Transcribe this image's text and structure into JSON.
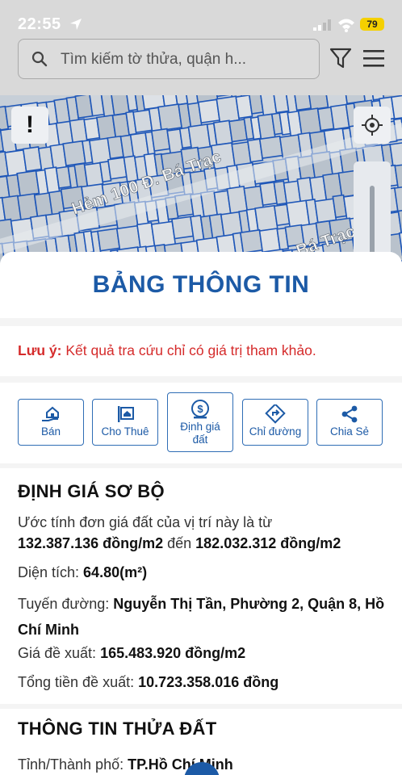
{
  "status": {
    "time": "22:55",
    "battery": "79"
  },
  "search": {
    "placeholder": "Tìm kiếm tờ thửa, quận h..."
  },
  "map": {
    "road_label": "Hẻm 100 Đ. Bá Trạc",
    "road_label_2": "Bá Trạc",
    "alert_symbol": "!"
  },
  "panel": {
    "title": "BẢNG THÔNG TIN",
    "note_label": "Lưu ý:",
    "note_text": " Kết quả tra cứu chỉ có giá trị tham khảo."
  },
  "actions": [
    {
      "label": "Bán",
      "icon": "house-hand-icon"
    },
    {
      "label": "Cho Thuê",
      "icon": "rent-sign-icon"
    },
    {
      "label": "Định giá đất",
      "icon": "money-bag-icon"
    },
    {
      "label": "Chỉ đường",
      "icon": "direction-icon"
    },
    {
      "label": "Chia Sẻ",
      "icon": "share-icon"
    }
  ],
  "valuation": {
    "heading": "ĐỊNH GIÁ SƠ BỘ",
    "estimate_prefix": "Ước tính đơn giá đất của vị trí này là từ",
    "price_min": "132.387.136 đồng/m2",
    "between": " đến ",
    "price_max": "182.032.312 đồng/m2",
    "area_label": "Diện tích: ",
    "area_value": "64.80(m²)",
    "road_label": "Tuyến đường: ",
    "road_value": "Nguyễn Thị Tần, Phường 2, Quận 8, Hồ Chí Minh",
    "suggest_label": "Giá đề xuất: ",
    "suggest_value": "165.483.920 đồng/m2",
    "total_label": "Tổng tiền đề xuất: ",
    "total_value": "10.723.358.016 đồng"
  },
  "parcel": {
    "heading": "THÔNG TIN THỬA ĐẤT",
    "city_label": "Tỉnh/Thành phố: ",
    "city_value": "TP.Hồ Chí Minh"
  },
  "colors": {
    "brand": "#1c5aa6",
    "warning": "#d52b2b"
  }
}
